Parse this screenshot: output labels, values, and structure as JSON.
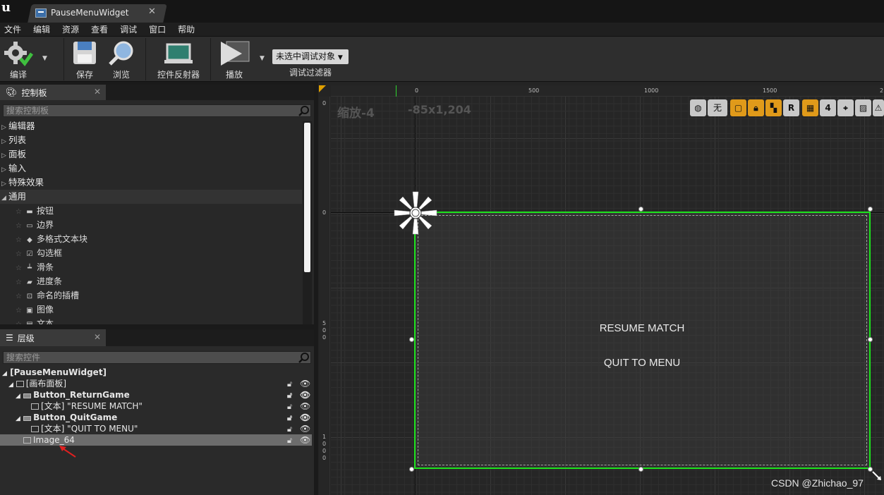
{
  "window": {
    "tab_title": "PauseMenuWidget"
  },
  "menu": [
    "文件",
    "编辑",
    "资源",
    "查看",
    "调试",
    "窗口",
    "帮助"
  ],
  "toolbar": {
    "compile": "编译",
    "save": "保存",
    "browse": "浏览",
    "widget_reflector": "控件反射器",
    "play": "播放",
    "debug_select": "未选中调试对象",
    "debug_filter": "调试过滤器"
  },
  "palette": {
    "title": "控制板",
    "search_placeholder": "搜索控制板",
    "categories": [
      "编辑器",
      "列表",
      "面板",
      "输入",
      "特殊效果",
      "通用"
    ],
    "items": [
      "按钮",
      "边界",
      "多格式文本块",
      "勾选框",
      "滑条",
      "进度条",
      "命名的插槽",
      "图像",
      "文本"
    ]
  },
  "hierarchy": {
    "title": "层级",
    "search_placeholder": "搜索控件",
    "rows": [
      {
        "label": "[PauseMenuWidget]"
      },
      {
        "label": "[画布面板]"
      },
      {
        "label": "Button_ReturnGame"
      },
      {
        "label": "[文本] \"RESUME MATCH\""
      },
      {
        "label": "Button_QuitGame"
      },
      {
        "label": "[文本] \"QUIT TO MENU\""
      },
      {
        "label": "Image_64"
      }
    ]
  },
  "canvas": {
    "zoom": "缩放-4",
    "coords": "-85x1,204",
    "ruler_top": [
      "0",
      "500",
      "1000",
      "1500",
      "2"
    ],
    "ruler_left": [
      "0",
      "0",
      "5\n0\n0",
      "1\n0\n0\n0"
    ],
    "resume_text": "RESUME MATCH",
    "quit_text": "QUIT TO MENU",
    "toolbar": {
      "none_label": "无",
      "r_label": "R",
      "four_label": "4"
    },
    "selection_color": "#1de21d"
  },
  "watermark": "CSDN @Zhichao_97"
}
